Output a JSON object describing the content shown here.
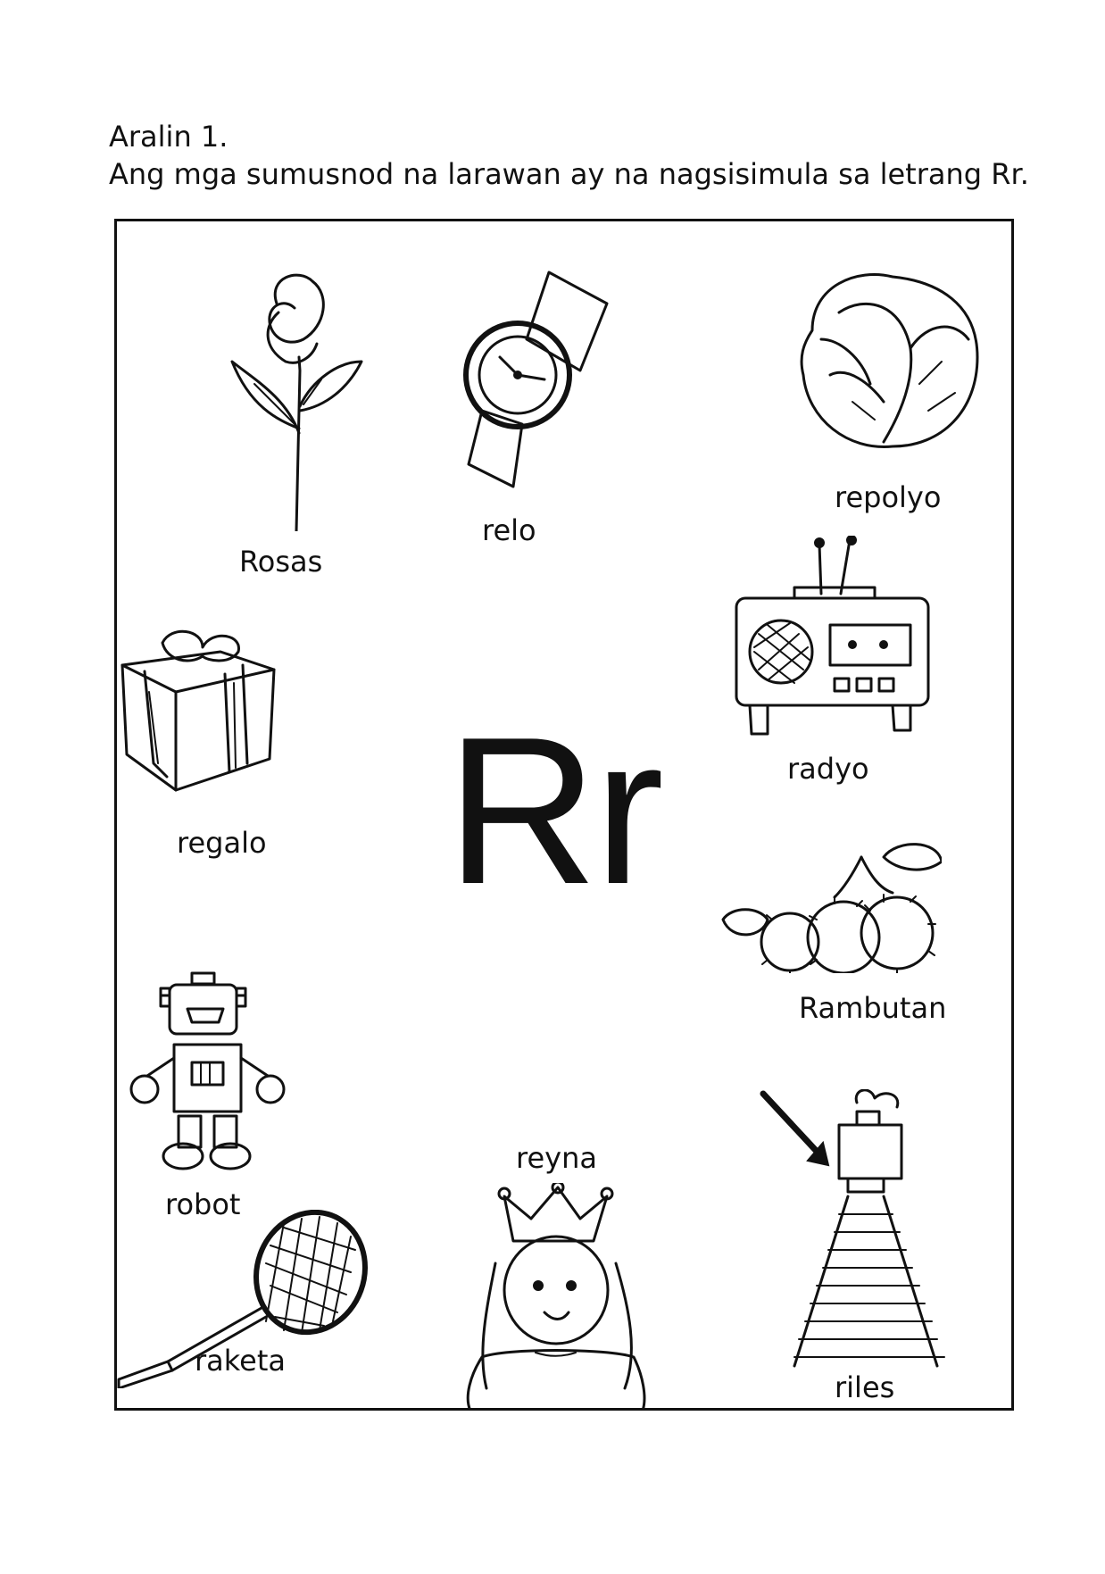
{
  "header": {
    "lesson": "Aralin 1.",
    "instruction": "Ang mga sumusnod na larawan ay na nagsisimula sa letrang Rr."
  },
  "center_letter": "Rr",
  "items": [
    {
      "id": "rose",
      "label": "Rosas",
      "icon": "rose-icon"
    },
    {
      "id": "watch",
      "label": "relo",
      "icon": "watch-icon"
    },
    {
      "id": "cabbage",
      "label": "repolyo",
      "icon": "cabbage-icon"
    },
    {
      "id": "radio",
      "label": "radyo",
      "icon": "radio-icon"
    },
    {
      "id": "gift",
      "label": "regalo",
      "icon": "gift-icon"
    },
    {
      "id": "rambutan",
      "label": "Rambutan",
      "icon": "rambutan-icon"
    },
    {
      "id": "robot",
      "label": "robot",
      "icon": "robot-icon"
    },
    {
      "id": "queen",
      "label": "reyna",
      "icon": "queen-icon"
    },
    {
      "id": "racket",
      "label": "raketa",
      "icon": "racket-icon"
    },
    {
      "id": "rails",
      "label": "riles",
      "icon": "rails-icon"
    }
  ]
}
